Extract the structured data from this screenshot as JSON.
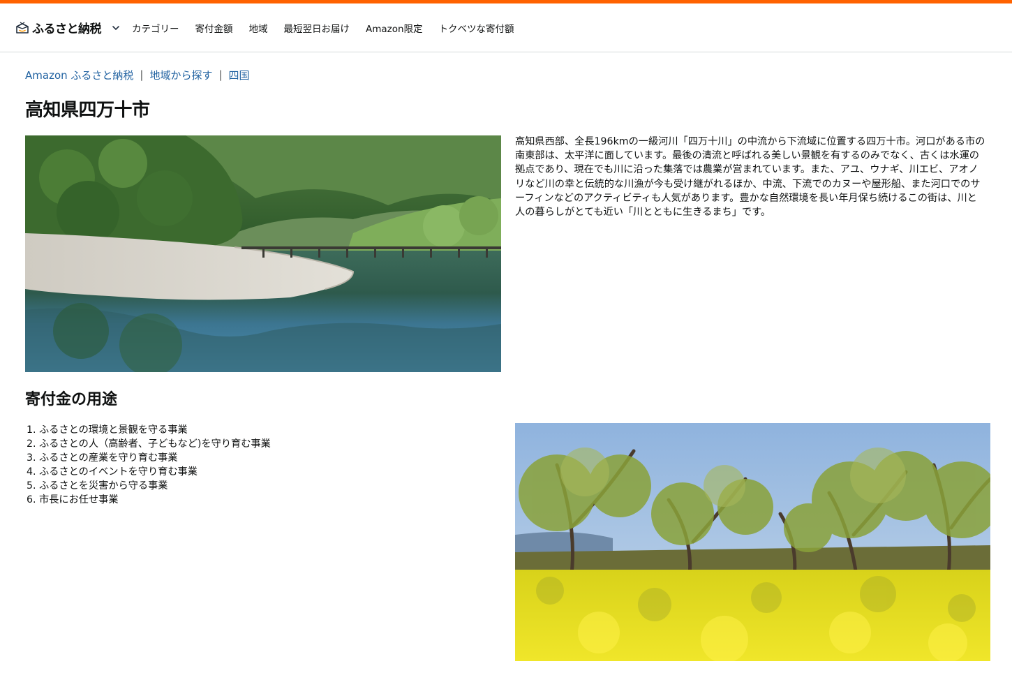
{
  "colors": {
    "accent": "#ff6200",
    "link": "#2162a1",
    "text": "#0f1111",
    "separator": "#565959",
    "border": "#d5d9d9"
  },
  "header": {
    "brand_label": "ふるさと納税",
    "brand_icon": "box-icon",
    "menu_icon": "chevron-down-icon",
    "nav": [
      "カテゴリー",
      "寄付金額",
      "地域",
      "最短翌日お届け",
      "Amazon限定",
      "トクベツな寄付額"
    ]
  },
  "breadcrumb": {
    "items": [
      "Amazon ふるさと納税",
      "地域から探す",
      "四国"
    ],
    "separator": "|"
  },
  "page": {
    "title": "高知県四万十市",
    "description": "高知県西部、全長196kmの一級河川「四万十川」の中流から下流域に位置する四万十市。河口がある市の南東部は、太平洋に面しています。最後の清流と呼ばれる美しい景観を有するのみでなく、古くは水運の拠点であり、現在でも川に沿った集落では農業が営まれています。また、アユ、ウナギ、川エビ、アオノリなど川の幸と伝統的な川漁が今も受け継がれるほか、中流、下流でのカヌーや屋形船、また河口でのサーフィンなどのアクティビティも人気があります。豊かな自然環境を長い年月保ち続けるこの街は、川と人の暮らしがとても近い「川とともに生きるまち」です。"
  },
  "usage": {
    "title": "寄付金の用途",
    "items": [
      "1. ふるさとの環境と景観を守る事業",
      "2. ふるさとの人（高齢者、子どもなど)を守り育む事業",
      "3. ふるさとの産業を守り育む事業",
      "4. ふるさとのイベントを守り育む事業",
      "5. ふるさとを災害から守る事業",
      "6. 市長にお任せ事業"
    ]
  }
}
